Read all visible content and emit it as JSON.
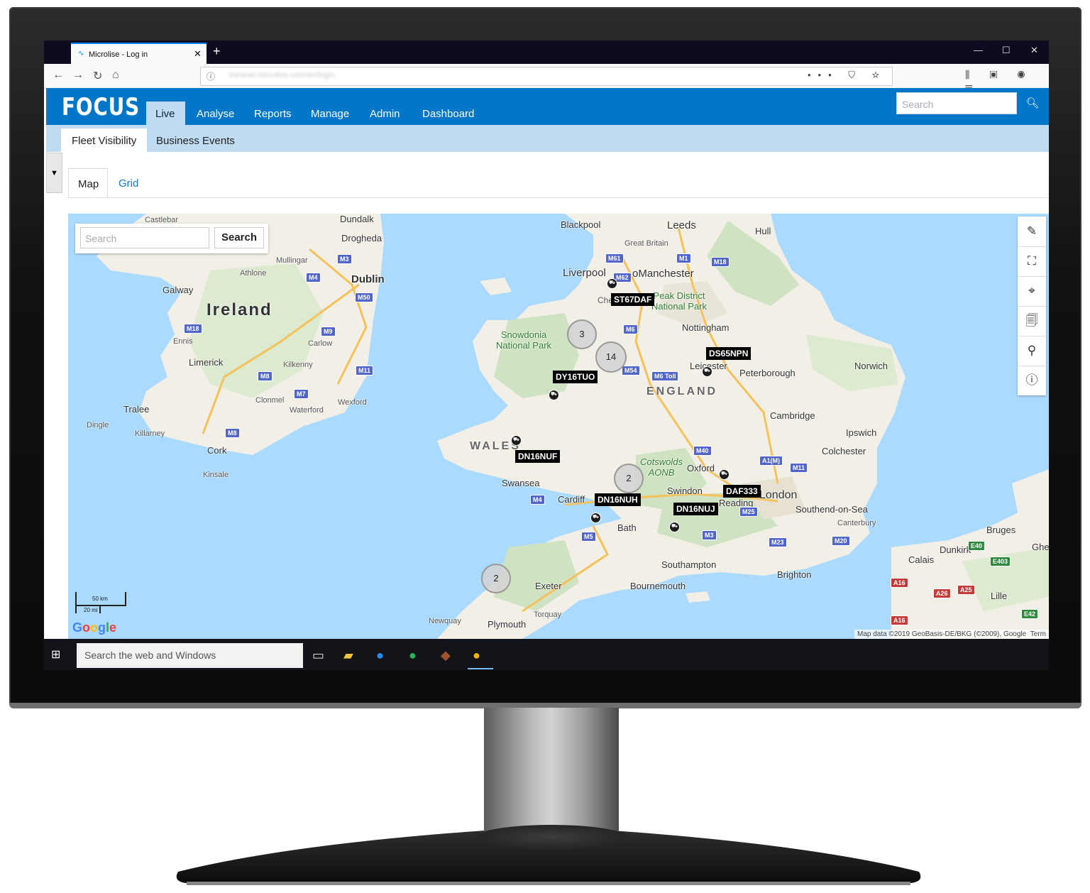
{
  "browser": {
    "tab_title": "Microlise - Log in",
    "tab_close": "✕",
    "new_tab": "+",
    "url": "intranet.microlise.com/en/login",
    "window_controls": [
      "—",
      "☐",
      "✕"
    ],
    "nav_icons": [
      "←",
      "→",
      "↻",
      "⌂"
    ],
    "url_icons": "••• ⛉ ☆",
    "tool_icons": "⫼ ▣ ◉ ☰"
  },
  "app": {
    "logo": "FOCUS",
    "nav": [
      "Live",
      "Analyse",
      "Reports",
      "Manage",
      "Admin",
      "Dashboard"
    ],
    "active_nav": "Live",
    "search_placeholder": "Search",
    "search_icon": "search-icon",
    "subtabs": [
      "Fleet Visibility",
      "Business Events"
    ],
    "active_subtab": "Fleet Visibility",
    "filter_icon": "▼",
    "view_tabs": [
      "Map",
      "Grid"
    ],
    "active_view": "Map"
  },
  "map": {
    "search_placeholder": "Search",
    "search_button": "Search",
    "tools": [
      "✎",
      "⛶",
      "⌖",
      "🗐",
      "⚲",
      "ⓘ"
    ],
    "tool_names": [
      "pencil-icon",
      "fullscreen-icon",
      "locate-icon",
      "document-search-icon",
      "location-pin-icon",
      "info-icon"
    ],
    "place_labels": {
      "ireland": "Ireland",
      "wales": "WALES",
      "england": "ENGLAND",
      "dublin": "Dublin",
      "galway": "Galway",
      "limerick": "Limerick",
      "cork": "Cork",
      "waterford": "Waterford",
      "kilkenny": "Kilkenny",
      "athlone": "Athlone",
      "mullingar": "Mullingar",
      "drogheda": "Drogheda",
      "dundalk": "Dundalk",
      "castlebar": "Castlebar",
      "ennis": "Ennis",
      "carlow": "Carlow",
      "clonmel": "Clonmel",
      "wexford": "Wexford",
      "tralee": "Tralee",
      "dingle": "Dingle",
      "killarney": "Killarney",
      "kinsale": "Kinsale",
      "blackpool": "Blackpool",
      "leeds": "Leeds",
      "hull": "Hull",
      "great_britain": "Great Britain",
      "liverpool": "Liverpool",
      "manchester": "oManchester",
      "chester": "Chester",
      "peak": "Peak District\nNational Park",
      "nottingham": "Nottingham",
      "leicester": "Leicester",
      "peterborough": "Peterborough",
      "norwich": "Norwich",
      "snowdonia": "Snowdonia\nNational Park",
      "cambridge": "Cambridge",
      "ipswich": "Ipswich",
      "colchester": "Colchester",
      "cotswolds": "Cotswolds\nAONB",
      "oxford": "Oxford",
      "swansea": "Swansea",
      "cardiff": "Cardiff",
      "swindon": "Swindon",
      "reading": "Reading",
      "london": "London",
      "southend": "Southend-on-Sea",
      "canterbury": "Canterbury",
      "bath": "Bath",
      "southampton": "Southampton",
      "brighton": "Brighton",
      "bournemouth": "Bournemouth",
      "exeter": "Exeter",
      "torquay": "Torquay",
      "plymouth": "Plymouth",
      "newquay": "Newquay",
      "calais": "Calais",
      "dunkirk": "Dunkirk",
      "bruges": "Bruges",
      "ghent": "Ghen",
      "lille": "Lille"
    },
    "roads": [
      "M3",
      "M4",
      "M50",
      "M18",
      "M9",
      "M11",
      "M8",
      "M7",
      "M6",
      "M61",
      "M62",
      "M1",
      "M18",
      "M54",
      "M6 Toll",
      "M40",
      "A1(M)",
      "M11",
      "M4",
      "M25",
      "M5",
      "M3",
      "M23",
      "M20",
      "E40",
      "E403",
      "A16",
      "A26",
      "A25",
      "E42",
      "A16"
    ],
    "clusters": [
      "3",
      "14",
      "2",
      "2"
    ],
    "vehicles": [
      {
        "reg": "ST67DAF"
      },
      {
        "reg": "DS65NPN"
      },
      {
        "reg": "DY16TUO"
      },
      {
        "reg": "DN16NUF"
      },
      {
        "reg": "DAF333"
      },
      {
        "reg": "DN16NUH"
      },
      {
        "reg": "DN16NUJ"
      }
    ],
    "scale_km": "50 km",
    "scale_mi": "20 mi",
    "google": "Google",
    "attribution": "Map data ©2019 GeoBasis-DE/BKG (©2009), Google",
    "terms": "Term"
  },
  "taskbar": {
    "search_placeholder": "Search the web and Windows",
    "icons": [
      "task-view-icon",
      "file-explorer-icon",
      "messenger-icon",
      "spotify-icon",
      "app-icon",
      "chrome-canary-icon"
    ]
  }
}
